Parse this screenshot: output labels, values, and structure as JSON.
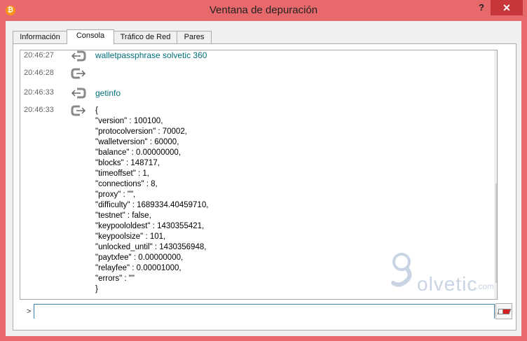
{
  "window": {
    "title": "Ventana de depuración",
    "help_label": "?",
    "close_label": "✕"
  },
  "tabs": [
    {
      "label": "Información"
    },
    {
      "label": "Consola"
    },
    {
      "label": "Tráfico de Red"
    },
    {
      "label": "Pares"
    }
  ],
  "active_tab": "Consola",
  "console": {
    "messages": [
      {
        "time": "20:46:27",
        "direction": "request",
        "text": "walletpassphrase solvetic 360"
      },
      {
        "time": "20:46:28",
        "direction": "reply",
        "text": ""
      },
      {
        "time": "20:46:33",
        "direction": "request",
        "text": "getinfo"
      },
      {
        "time": "20:46:33",
        "direction": "reply",
        "text": "{\n\"version\" : 100100,\n\"protocolversion\" : 70002,\n\"walletversion\" : 60000,\n\"balance\" : 0.00000000,\n\"blocks\" : 148717,\n\"timeoffset\" : 1,\n\"connections\" : 8,\n\"proxy\" : \"\",\n\"difficulty\" : 1689334.40459710,\n\"testnet\" : false,\n\"keypoololdest\" : 1430355421,\n\"keypoolsize\" : 101,\n\"unlocked_until\" : 1430356948,\n\"paytxfee\" : 0.00000000,\n\"relayfee\" : 0.00001000,\n\"errors\" : \"\"\n}"
      }
    ],
    "scroll_up_icon": "▲",
    "scroll_down_icon": "▼"
  },
  "watermark": {
    "text": "olvetic",
    "suffix": ".com"
  },
  "input": {
    "prompt": ">",
    "value": "",
    "placeholder": ""
  },
  "icons": {
    "request": "arrow-left-icon",
    "reply": "arrow-right-icon",
    "clear": "eraser-icon",
    "app": "bitcoin-icon"
  },
  "colors": {
    "titlebar": "#e8696b",
    "close": "#c7373a",
    "command_text": "#006f78",
    "input_border": "#3c7fb1"
  }
}
